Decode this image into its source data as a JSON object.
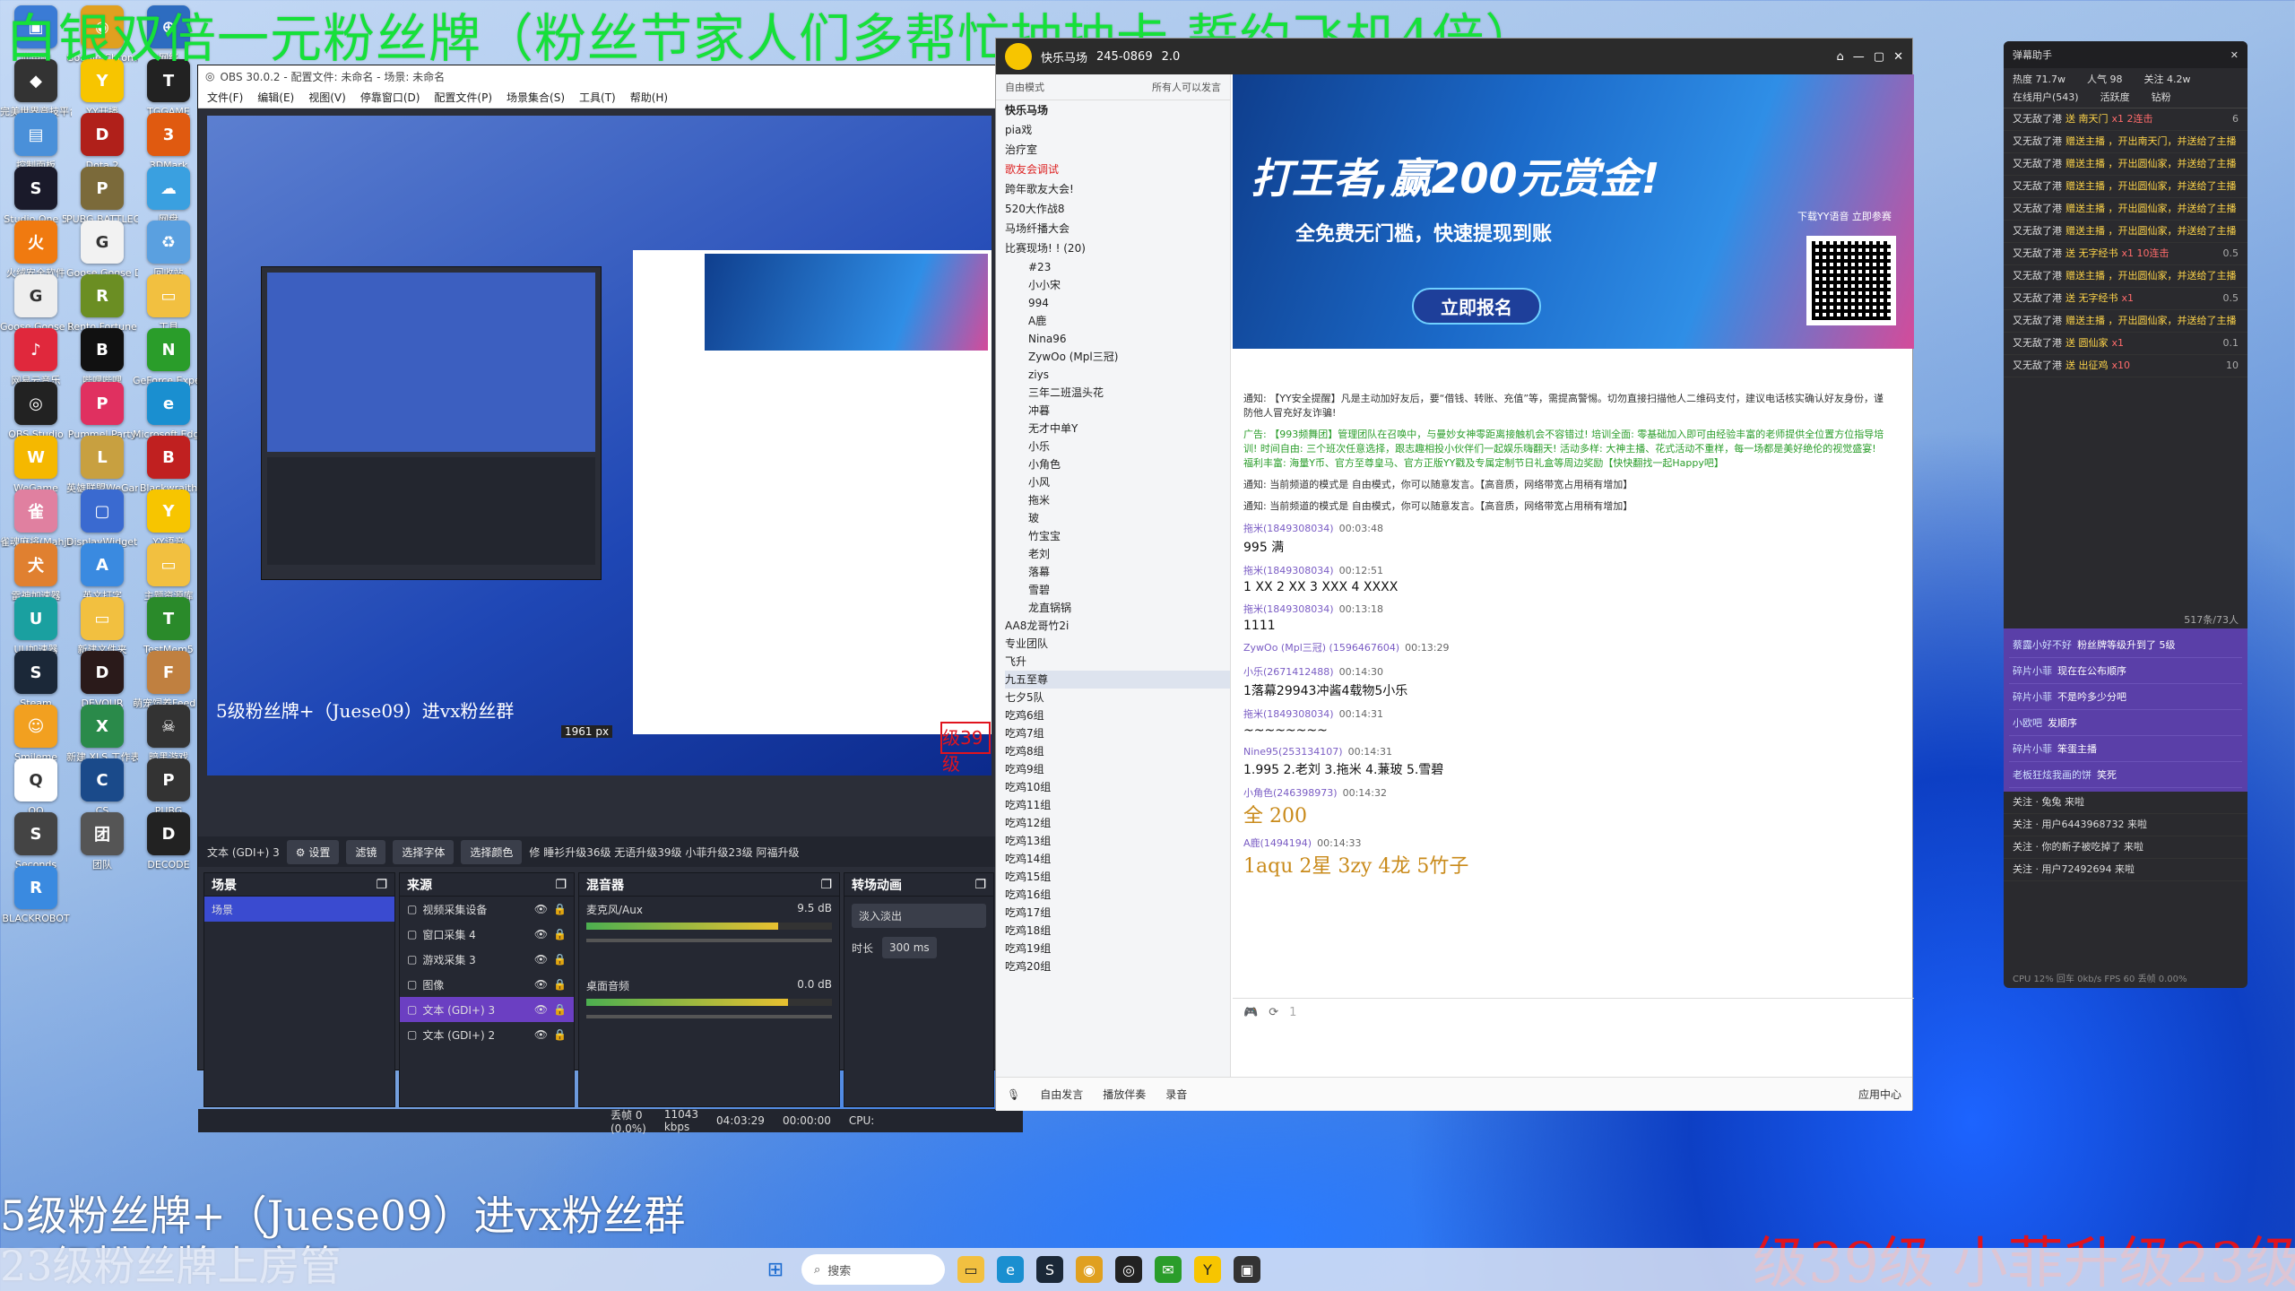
{
  "overlay": {
    "top_green": "白银双倍一元粉丝牌（粉丝节家人们多帮忙抽抽卡  誓约飞机4倍）",
    "bottom_white_1": "5级粉丝牌+（Juese09）进vx粉丝群",
    "bottom_white_2": "23级粉丝牌上房管",
    "bottom_red": "级39级 小菲升级23级"
  },
  "desktop_icons": [
    {
      "label": "此电脑",
      "color": "#3a7bd5",
      "glyph": "▣"
    },
    {
      "label": "Google Chrome",
      "color": "#e0a020",
      "glyph": "◉"
    },
    {
      "label": "网络",
      "color": "#2d6cc0",
      "glyph": "⊕"
    },
    {
      "label": "完美世界竞技平台",
      "color": "#333",
      "glyph": "◆"
    },
    {
      "label": "YY开播",
      "color": "#f7c500",
      "glyph": "Y"
    },
    {
      "label": "TGGAME",
      "color": "#222",
      "glyph": "T"
    },
    {
      "label": "控制面板",
      "color": "#4a90d9",
      "glyph": "▤"
    },
    {
      "label": "Dota 2",
      "color": "#b0201a",
      "glyph": "D"
    },
    {
      "label": "3DMark",
      "color": "#e05a10",
      "glyph": "3"
    },
    {
      "label": "Studio One 5",
      "color": "#1a1a2a",
      "glyph": "S"
    },
    {
      "label": "PUBG BATTLEGR...",
      "color": "#7b6a3a",
      "glyph": "P"
    },
    {
      "label": "网盘",
      "color": "#3aa0e0",
      "glyph": "☁"
    },
    {
      "label": "火绒安全软件",
      "color": "#f07a10",
      "glyph": "火"
    },
    {
      "label": "Goose Goose Duck",
      "color": "#f2f2f2",
      "glyph": "G"
    },
    {
      "label": "回收站",
      "color": "#5aa0e0",
      "glyph": "♻"
    },
    {
      "label": "Goose Goose Duck",
      "color": "#eee",
      "glyph": "G"
    },
    {
      "label": "Rento Fortune",
      "color": "#6b8e23",
      "glyph": "R"
    },
    {
      "label": "工具",
      "color": "#f2c040",
      "glyph": "▭"
    },
    {
      "label": "网易云音乐",
      "color": "#e0283c",
      "glyph": "♪"
    },
    {
      "label": "哔哩哔哩",
      "color": "#111",
      "glyph": "B"
    },
    {
      "label": "GeForce Experience",
      "color": "#2a9d2a",
      "glyph": "N"
    },
    {
      "label": "OBS Studio",
      "color": "#222",
      "glyph": "◎"
    },
    {
      "label": "Pummel Party",
      "color": "#e03060",
      "glyph": "P"
    },
    {
      "label": "Microsoft Edge",
      "color": "#1a8fd0",
      "glyph": "e"
    },
    {
      "label": "WeGame",
      "color": "#f5b800",
      "glyph": "W"
    },
    {
      "label": "英雄联盟WeGame版",
      "color": "#c8a040",
      "glyph": "L"
    },
    {
      "label": "Blackwraith",
      "color": "#c02020",
      "glyph": "B"
    },
    {
      "label": "雀魂麻将(Mahjong...)",
      "color": "#e080a0",
      "glyph": "雀"
    },
    {
      "label": "DisplayWidget Center",
      "color": "#3a6ad0",
      "glyph": "▢"
    },
    {
      "label": "YY语音",
      "color": "#f7c500",
      "glyph": "Y"
    },
    {
      "label": "雷神加速器",
      "color": "#e08030",
      "glyph": "犬"
    },
    {
      "label": "英文打字",
      "color": "#3a8ae0",
      "glyph": "A"
    },
    {
      "label": "主题资源库",
      "color": "#f2c040",
      "glyph": "▭"
    },
    {
      "label": "UU加速器",
      "color": "#1aa0a0",
      "glyph": "U"
    },
    {
      "label": "新建文件夹",
      "color": "#f2c040",
      "glyph": "▭"
    },
    {
      "label": "TestMem5",
      "color": "#2a8a2a",
      "glyph": "T"
    },
    {
      "label": "Steam",
      "color": "#1b2838",
      "glyph": "S"
    },
    {
      "label": "DEVOUR",
      "color": "#2a1a1a",
      "glyph": "D"
    },
    {
      "label": "萌宠饲养Feed T...",
      "color": "#c08040",
      "glyph": "F"
    },
    {
      "label": "Smileme",
      "color": "#f2a020",
      "glyph": "☺"
    },
    {
      "label": "新建 XLS 工作表.xls",
      "color": "#2a8a4a",
      "glyph": "X"
    },
    {
      "label": "暗黑游戏",
      "color": "#333",
      "glyph": "☠"
    },
    {
      "label": "QQ",
      "color": "#fff",
      "glyph": "Q"
    },
    {
      "label": "CS",
      "color": "#1a4a8a",
      "glyph": "C"
    },
    {
      "label": "PUBG",
      "color": "#333",
      "glyph": "P"
    },
    {
      "label": "Seconds",
      "color": "#444",
      "glyph": "S"
    },
    {
      "label": "团队",
      "color": "#555",
      "glyph": "团"
    },
    {
      "label": "DECODE",
      "color": "#222",
      "glyph": "D"
    },
    {
      "label": "BLACKROBOT",
      "color": "#3a8ae0",
      "glyph": "R"
    }
  ],
  "obs": {
    "title": "OBS 30.0.2 - 配置文件: 未命名 - 场景: 未命名",
    "menu": [
      "文件(F)",
      "编辑(E)",
      "视图(V)",
      "停靠窗口(D)",
      "配置文件(P)",
      "场景集合(S)",
      "工具(T)",
      "帮助(H)"
    ],
    "selected_source": "文本 (GDI+) 3",
    "ctrl_buttons": [
      "⚙ 设置",
      "滤镜",
      "选择字体",
      "选择颜色"
    ],
    "ctrl_text": "修 睡衫升级36级 无语升级39级 小菲升级23级 阿福升级",
    "docks": {
      "scenes": {
        "title": "场景",
        "items": [
          "场景"
        ]
      },
      "sources": {
        "title": "来源",
        "items": [
          "视频采集设备",
          "窗口采集 4",
          "游戏采集 3",
          "图像",
          "文本 (GDI+) 3",
          "文本 (GDI+) 2"
        ]
      },
      "mixer": {
        "title": "混音器",
        "ch1": "麦克风/Aux",
        "ch1_db": "9.5 dB",
        "ch2": "桌面音频",
        "ch2_db": "0.0 dB",
        "ch1_level": 0.78,
        "ch2_level": 0.82
      },
      "transitions": {
        "title": "转场动画",
        "type": "淡入淡出",
        "duration_label": "时长",
        "duration": "300 ms"
      }
    },
    "status": {
      "dropped": "丢帧 0 (0.0%)",
      "bitrate": "11043 kbps",
      "stream_time": "04:03:29",
      "rec_time": "00:00:00",
      "cpu": "CPU:"
    },
    "preview_text1": "5级粉丝牌+（Juese09）进vx粉丝群",
    "preview_size": "1961 px",
    "preview_red": "级39级"
  },
  "yy": {
    "channel": "快乐马场",
    "channel_id": "245-0869",
    "viewers": "2.0",
    "mode_label": "自由模式",
    "mode_right": "所有人可以发言",
    "tree": [
      {
        "label": "快乐马场",
        "bold": true
      },
      {
        "label": "pia戏"
      },
      {
        "label": "治疗室"
      },
      {
        "label": "歌友会调试",
        "red": true
      },
      {
        "label": "跨年歌友大会!"
      },
      {
        "label": "520大作战8"
      },
      {
        "label": "马场纤播大会"
      },
      {
        "label": "比赛现场! ! (20)"
      }
    ],
    "users": [
      "#23",
      "小小宋",
      "994",
      "A鹿",
      "Nina96",
      "ZywOo (Mpl三冠)",
      "ziys",
      "三年二班温头花",
      "冲暮",
      "无才中单Y",
      "小乐",
      "小角色",
      "小风",
      "拖米",
      "玻",
      "竹宝宝",
      "老刘",
      "落幕",
      "雪碧",
      "龙直锅锅"
    ],
    "rooms": [
      "AA8龙哥竹2i",
      "专业团队",
      "飞升",
      "九五至尊",
      "七夕5队",
      "吃鸡6组",
      "吃鸡7组",
      "吃鸡8组",
      "吃鸡9组",
      "吃鸡10组",
      "吃鸡11组",
      "吃鸡12组",
      "吃鸡13组",
      "吃鸡14组",
      "吃鸡15组",
      "吃鸡16组",
      "吃鸡17组",
      "吃鸡18组",
      "吃鸡19组",
      "吃鸡20组"
    ],
    "banner": {
      "title": "打王者,赢200元赏金!",
      "sub": "全免费无门槛，快速提现到账",
      "btn": "立即报名",
      "qr": "下载YY语音 立即参赛"
    },
    "notices": [
      "通知: 【YY安全提醒】凡是主动加好友后，要“借钱、转账、充值”等，需提高警惕。切勿直接扫描他人二维码支付，建议电话核实确认好友身份，谨防他人冒充好友诈骗!",
      "广告: 【993频舞团】管理团队在召唤中，与曼妙女神零距离接触机会不容错过! 培训全面: 零基础加入即可由经验丰富的老师提供全位置方位指导培训! 时间自由: 三个班次任意选择，跟志趣相投小伙伴们一起娱乐嗨翻天! 活动多样: 大神主播、花式活动不重样，每一场都是美好绝伦的视觉盛宴! 福利丰富: 海量Y币、官方至尊皇马、官方正版YY戳及专属定制节日礼盒等周边奖励【快快翻找一起Happy吧】",
      "通知: 当前频道的模式是 自由模式，你可以随意发言。【高音质，网络带宽占用稍有增加】",
      "通知: 当前频道的模式是 自由模式，你可以随意发言。【高音质，网络带宽占用稍有增加】"
    ],
    "messages": [
      {
        "name": "拖米(1849308034)",
        "time": "00:03:48",
        "text": "995 满"
      },
      {
        "name": "拖米(1849308034)",
        "time": "00:12:51",
        "text": "1  XX 2 XX 3   XXX 4   XXXX"
      },
      {
        "name": "拖米(1849308034)",
        "time": "00:13:18",
        "text": "1111"
      },
      {
        "name": "ZywOo (Mpl三冠) (1596467604)",
        "time": "00:13:29",
        "text": ""
      },
      {
        "name": "小乐(2671412488)",
        "time": "00:14:30",
        "text": "1落幕29943冲酱4载物5小乐"
      },
      {
        "name": "拖米(1849308034)",
        "time": "00:14:31",
        "text": "~~~~~~~~"
      },
      {
        "name": "Nine95(253134107)",
        "time": "00:14:31",
        "text": "1.995 2.老刘 3.拖米 4.蒹玻 5.雪碧"
      },
      {
        "name": "小角色(246398973)",
        "time": "00:14:32",
        "text": "全 200"
      },
      {
        "name": "A鹿(1494194)",
        "time": "00:14:33",
        "text": "1aqu   2星   3zy 4龙 5竹子"
      }
    ],
    "input_value": "1",
    "bottom": [
      "自由发言",
      "播放伴奏",
      "录音",
      "应用中心"
    ]
  },
  "rightpanel": {
    "title": "弹幕助手",
    "stats": [
      "热度 71.7w",
      "人气 98",
      "关注 4.2w",
      "在线用户(543)",
      "活跃度",
      "钻粉"
    ],
    "gifts": [
      {
        "user": "又无敌了港",
        "text": "送 南天门",
        "count": "x1 2连击",
        "val": "6"
      },
      {
        "user": "又无敌了港",
        "text": "赠送主播 ，开出南天门，并送给了主播",
        "count": "",
        "val": ""
      },
      {
        "user": "又无敌了港",
        "text": "赠送主播 ，开出圆仙家，并送给了主播",
        "count": "",
        "val": ""
      },
      {
        "user": "又无敌了港",
        "text": "赠送主播 ，开出圆仙家，并送给了主播",
        "count": "",
        "val": ""
      },
      {
        "user": "又无敌了港",
        "text": "赠送主播 ，开出圆仙家，并送给了主播",
        "count": "",
        "val": ""
      },
      {
        "user": "又无敌了港",
        "text": "赠送主播 ，开出圆仙家，并送给了主播",
        "count": "",
        "val": ""
      },
      {
        "user": "又无敌了港",
        "text": "送 无字经书",
        "count": "x1 10连击",
        "val": "0.5"
      },
      {
        "user": "又无敌了港",
        "text": "赠送主播 ，开出圆仙家，并送给了主播",
        "count": "",
        "val": ""
      },
      {
        "user": "又无敌了港",
        "text": "送 无字经书",
        "count": "x1",
        "val": "0.5"
      },
      {
        "user": "又无敌了港",
        "text": "赠送主播 ，开出圆仙家，并送给了主播",
        "count": "",
        "val": ""
      },
      {
        "user": "又无敌了港",
        "text": "送 圆仙家",
        "count": "x1",
        "val": "0.1"
      },
      {
        "user": "又无敌了港",
        "text": "送 出征鸡",
        "count": "x10",
        "val": "10"
      }
    ],
    "counter": "517条/73人",
    "chat": [
      {
        "user": "蔡露小好不好",
        "text": "粉丝牌等级升到了 5级"
      },
      {
        "user": "碎片小菲",
        "text": "现在在公布顺序"
      },
      {
        "user": "碎片小菲",
        "text": "不是吟多少分吧"
      },
      {
        "user": "小欧吧",
        "text": "发顺序"
      },
      {
        "user": "碎片小菲",
        "text": "笨蛋主播"
      },
      {
        "user": "老板狂炫我画的饼",
        "text": "笑死"
      }
    ],
    "follows": [
      "关注 · 兔兔 来啦",
      "关注 · 用户6443968732 来啦",
      "关注 · 你的新子被吃掉了 来啦",
      "关注 · 用户72492694 来啦"
    ],
    "footer": "CPU 12%  回车 0kb/s  FPS 60      丢帧 0.00%"
  },
  "taskbar": {
    "search": "搜索"
  }
}
